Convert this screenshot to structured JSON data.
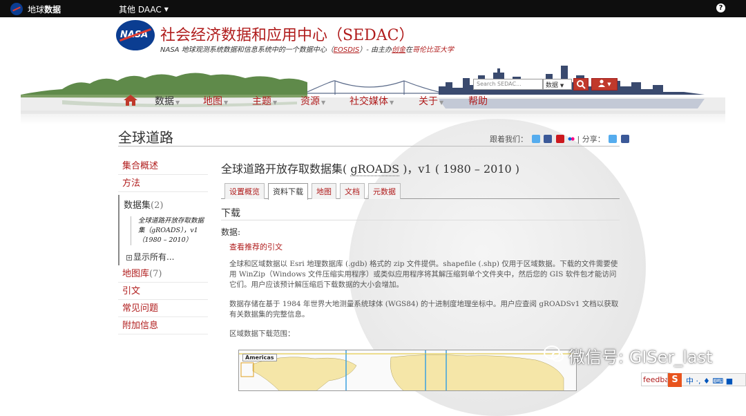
{
  "topbar": {
    "brand_prefix": "地球",
    "brand_bold": "数据",
    "daac": "其他 DAAC",
    "help": "?"
  },
  "header": {
    "nasa": "NASA",
    "title": "社会经济数据和应用中心（SEDAC）",
    "sub_a": "NASA 地球观测系统数据和信息系统中的一个数据中心（",
    "sub_eosdis": "EOSDIS",
    "sub_b": "）- 由主办",
    "sub_ciesin": "创金",
    "sub_c": "在",
    "sub_univ": "哥伦比亚大学",
    "search_placeholder": "Search SEDAC...",
    "search_scope": "数据"
  },
  "nav": {
    "items": [
      "数据",
      "地图",
      "主题",
      "资源",
      "社交媒体",
      "关于",
      "帮助"
    ]
  },
  "page": {
    "title": "全球道路",
    "follow": "跟着我们：",
    "share": "| 分享："
  },
  "sidebar": {
    "overview": "集合概述",
    "methods": "方法",
    "datasets_label": "数据集",
    "datasets_count": "(2)",
    "dataset_item": "全球道路开放存取数据集（gROADS），v1（1980 – 2010）",
    "show_all": "显示所有...",
    "map_gallery": "地图库",
    "map_gallery_count": "(7)",
    "citation": "引文",
    "faq": "常见问题",
    "additional": "附加信息"
  },
  "main": {
    "title_a": "全球道路开放存取数据集(",
    "title_abbr": "gROADS",
    "title_b": ")，v1 ( 1980 – 2010 )",
    "tabs": [
      "设置概览",
      "资料下载",
      "地图",
      "文档",
      "元数据"
    ],
    "download_heading": "下载",
    "data_label": "数据:",
    "cite_link": "查看推荐的引文",
    "para1": "全球和区域数据以 Esri 地理数据库 (.gdb) 格式的 zip 文件提供。shapefile (.shp) 仅用于区域数据。下载的文件需要使用 WinZip（Windows 文件压缩实用程序）或类似应用程序将其解压缩到单个文件夹中，然后您的 GIS 软件包才能访问它们。用户应该预计解压缩后下载数据的大小会增加。",
    "para2": "数据存储在基于 1984 年世界大地测量系统球体 (WGS84) 的十进制度地理坐标中。用户应查阅 gROADSv1 文档以获取有关数据集的完整信息。",
    "para3": "区域数据下载范围：",
    "map_label": "Americas"
  },
  "overlay": {
    "watermark": "微信号: GISer_last",
    "feedback": "feedback",
    "ime_s": "S",
    "ime_zh": "中 ·, ♦ ⌨ ■"
  }
}
